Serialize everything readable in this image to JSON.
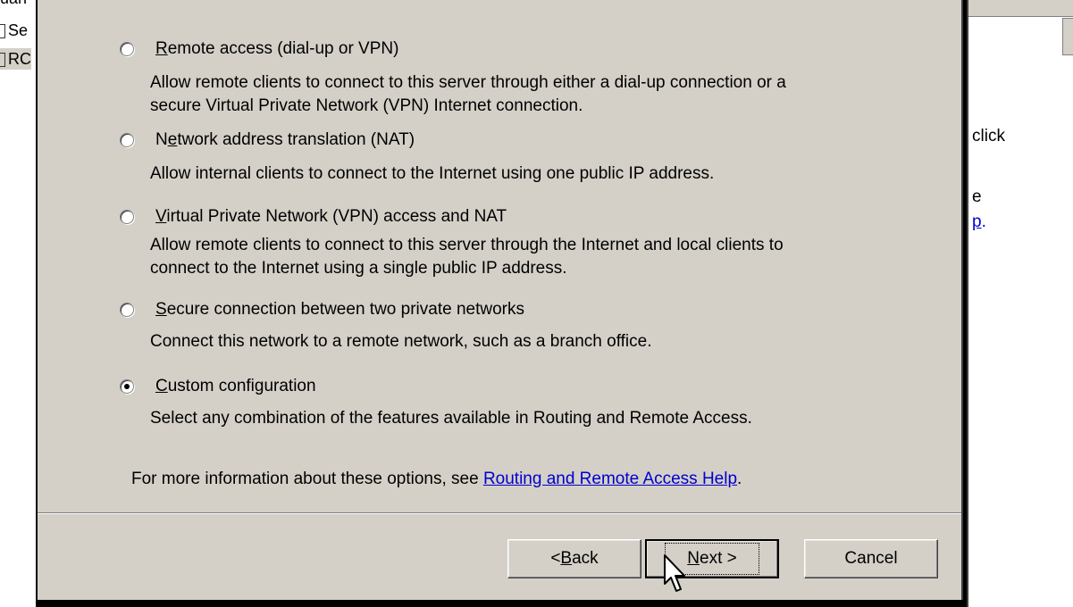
{
  "background_left": {
    "row1": "uan",
    "row2": "Se",
    "row3": "RC"
  },
  "background_right": {
    "line1": "click",
    "line2": "e",
    "line3": "p",
    "line3_suffix": "."
  },
  "options": [
    {
      "label_prefix": "",
      "label_mnemonic": "R",
      "label_rest": "emote access (dial-up or VPN)",
      "description": "Allow remote clients to connect to this server through either a dial-up connection or a\nsecure Virtual Private Network (VPN) Internet connection.",
      "checked": false
    },
    {
      "label_prefix": "N",
      "label_mnemonic": "e",
      "label_rest": "twork address translation (NAT)",
      "description": "Allow internal clients to connect to the Internet using one public IP address.",
      "checked": false
    },
    {
      "label_prefix": "",
      "label_mnemonic": "V",
      "label_rest": "irtual Private Network (VPN) access and NAT",
      "description": "Allow remote clients to connect to this server through the Internet and local clients to\nconnect to the Internet using a single public IP address.",
      "checked": false
    },
    {
      "label_prefix": "",
      "label_mnemonic": "S",
      "label_rest": "ecure connection between two private networks",
      "description": "Connect this network to a remote network, such as a branch office.",
      "checked": false
    },
    {
      "label_prefix": "",
      "label_mnemonic": "C",
      "label_rest": "ustom configuration",
      "description": "Select any combination of the features available in Routing and Remote Access.",
      "checked": true
    }
  ],
  "info": {
    "text": "For more information about these options, see ",
    "link": "Routing and Remote Access Help",
    "suffix": "."
  },
  "buttons": {
    "back": {
      "prefix": "< ",
      "mnemonic": "B",
      "rest": "ack"
    },
    "next": {
      "mnemonic": "N",
      "rest": "ext >"
    },
    "cancel": "Cancel"
  }
}
